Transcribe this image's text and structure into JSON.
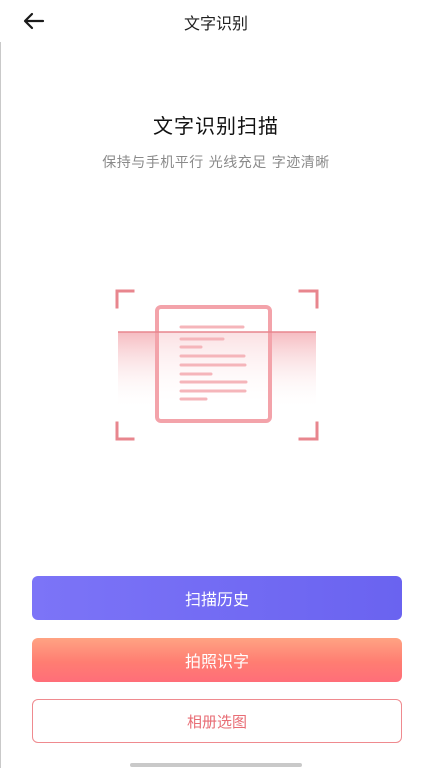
{
  "header": {
    "title": "文字识别",
    "back_icon": "arrow-left-icon"
  },
  "main": {
    "heading": "文字识别扫描",
    "subheading": "保持与手机平行 光线充足 字迹清晰",
    "illustration_icon": "document-scan-icon"
  },
  "actions": {
    "history_label": "扫描历史",
    "photo_label": "拍照识字",
    "album_label": "相册选图"
  },
  "colors": {
    "history_button": "#6f69f3",
    "photo_button_start": "#ffa383",
    "photo_button_end": "#ff6e79",
    "album_border": "#ef8a8f",
    "scan_accent": "#e8868e"
  }
}
